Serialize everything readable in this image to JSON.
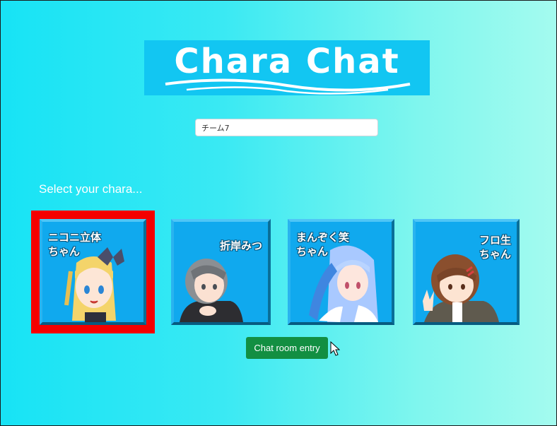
{
  "app": {
    "title": "Chara Chat"
  },
  "team_input": {
    "value": "チーム7"
  },
  "prompt": "Select your chara...",
  "characters": [
    {
      "label": "ニコニ立体\nちゃん",
      "selected": true
    },
    {
      "label": "折岸みつ",
      "selected": false
    },
    {
      "label": "まんぞく笑\nちゃん",
      "selected": false
    },
    {
      "label": "フロ生\nちゃん",
      "selected": false
    }
  ],
  "entry_button": {
    "label": "Chat room entry"
  },
  "colors": {
    "background_left": "#17e3f5",
    "background_right": "#a4fbef",
    "logo_bg": "#12c6f2",
    "card_bg": "#10a9ee",
    "selected_border": "#f40000",
    "entry_button": "#128f42"
  }
}
